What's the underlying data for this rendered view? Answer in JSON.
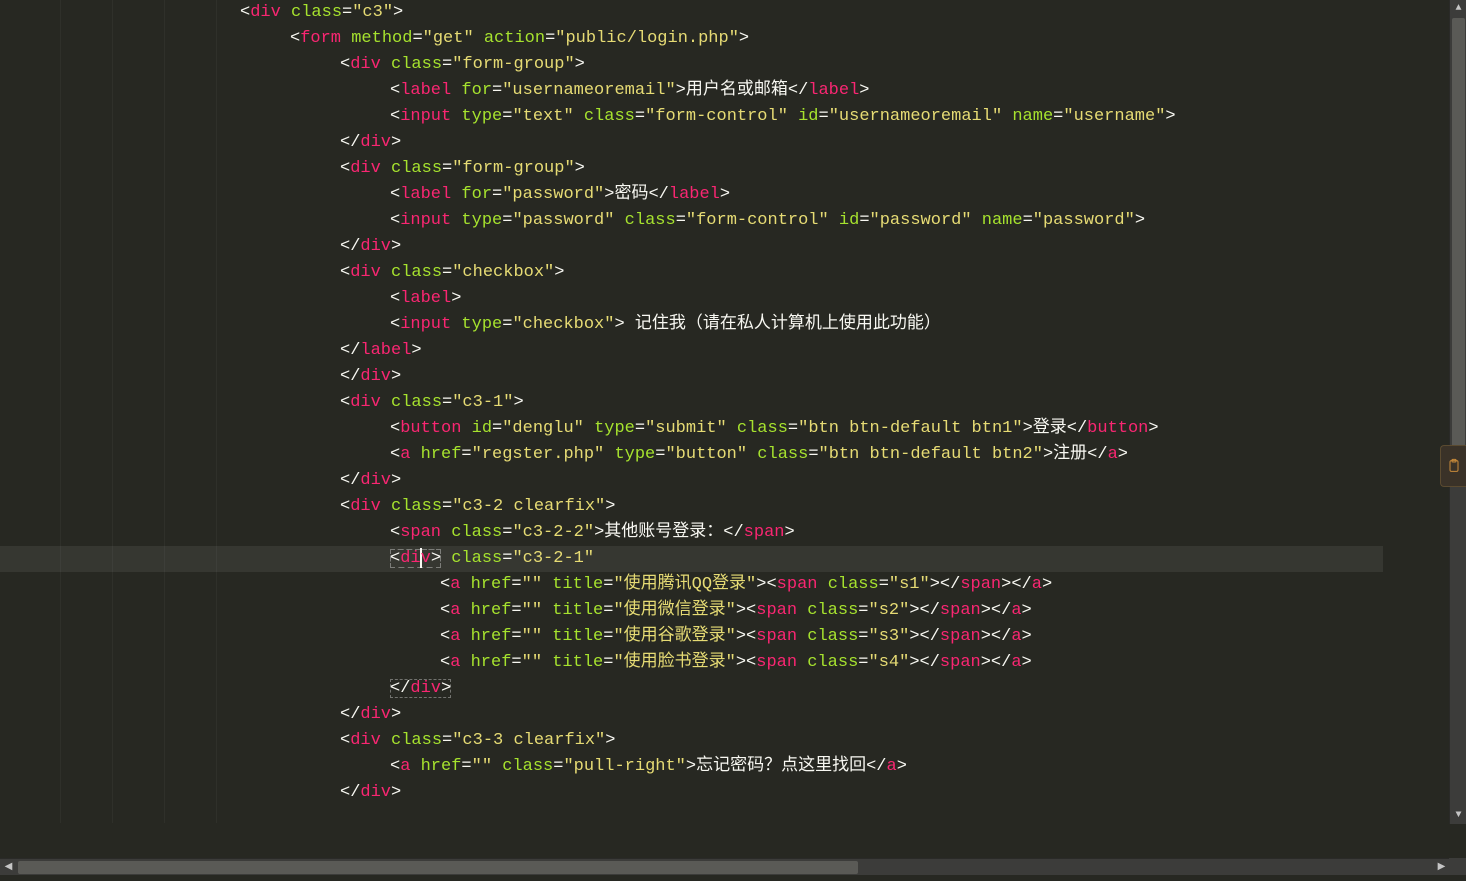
{
  "editor": {
    "indent_guides": 4,
    "highlighted_line_index": 21,
    "tokens": [
      [
        [
          "i",
          240
        ],
        [
          "p",
          "<"
        ],
        [
          "t",
          "div"
        ],
        [
          "p",
          " "
        ],
        [
          "a",
          "class"
        ],
        [
          "p",
          "="
        ],
        [
          "s",
          "\"c3\""
        ],
        [
          "p",
          ">"
        ]
      ],
      [
        [
          "i",
          290
        ],
        [
          "p",
          "<"
        ],
        [
          "t",
          "form"
        ],
        [
          "p",
          " "
        ],
        [
          "a",
          "method"
        ],
        [
          "p",
          "="
        ],
        [
          "s",
          "\"get\""
        ],
        [
          "p",
          " "
        ],
        [
          "a",
          "action"
        ],
        [
          "p",
          "="
        ],
        [
          "s",
          "\"public/login.php\""
        ],
        [
          "p",
          ">"
        ]
      ],
      [
        [
          "i",
          340
        ],
        [
          "p",
          "<"
        ],
        [
          "t",
          "div"
        ],
        [
          "p",
          " "
        ],
        [
          "a",
          "class"
        ],
        [
          "p",
          "="
        ],
        [
          "s",
          "\"form-group\""
        ],
        [
          "p",
          ">"
        ]
      ],
      [
        [
          "i",
          390
        ],
        [
          "p",
          "<"
        ],
        [
          "t",
          "label"
        ],
        [
          "p",
          " "
        ],
        [
          "a",
          "for"
        ],
        [
          "p",
          "="
        ],
        [
          "s",
          "\"usernameoremail\""
        ],
        [
          "p",
          ">"
        ],
        [
          "x",
          "用户名或邮箱"
        ],
        [
          "p",
          "</"
        ],
        [
          "t",
          "label"
        ],
        [
          "p",
          ">"
        ]
      ],
      [
        [
          "i",
          390
        ],
        [
          "p",
          "<"
        ],
        [
          "t",
          "input"
        ],
        [
          "p",
          " "
        ],
        [
          "a",
          "type"
        ],
        [
          "p",
          "="
        ],
        [
          "s",
          "\"text\""
        ],
        [
          "p",
          " "
        ],
        [
          "a",
          "class"
        ],
        [
          "p",
          "="
        ],
        [
          "s",
          "\"form-control\""
        ],
        [
          "p",
          " "
        ],
        [
          "a",
          "id"
        ],
        [
          "p",
          "="
        ],
        [
          "s",
          "\"usernameoremail\""
        ],
        [
          "p",
          " "
        ],
        [
          "a",
          "name"
        ],
        [
          "p",
          "="
        ],
        [
          "s",
          "\"username\""
        ],
        [
          "p",
          ">"
        ]
      ],
      [
        [
          "i",
          340
        ],
        [
          "p",
          "</"
        ],
        [
          "t",
          "div"
        ],
        [
          "p",
          ">"
        ]
      ],
      [
        [
          "i",
          340
        ],
        [
          "p",
          "<"
        ],
        [
          "t",
          "div"
        ],
        [
          "p",
          " "
        ],
        [
          "a",
          "class"
        ],
        [
          "p",
          "="
        ],
        [
          "s",
          "\"form-group\""
        ],
        [
          "p",
          ">"
        ]
      ],
      [
        [
          "i",
          390
        ],
        [
          "p",
          "<"
        ],
        [
          "t",
          "label"
        ],
        [
          "p",
          " "
        ],
        [
          "a",
          "for"
        ],
        [
          "p",
          "="
        ],
        [
          "s",
          "\"password\""
        ],
        [
          "p",
          ">"
        ],
        [
          "x",
          "密码"
        ],
        [
          "p",
          "</"
        ],
        [
          "t",
          "label"
        ],
        [
          "p",
          ">"
        ]
      ],
      [
        [
          "i",
          390
        ],
        [
          "p",
          "<"
        ],
        [
          "t",
          "input"
        ],
        [
          "p",
          " "
        ],
        [
          "a",
          "type"
        ],
        [
          "p",
          "="
        ],
        [
          "s",
          "\"password\""
        ],
        [
          "p",
          " "
        ],
        [
          "a",
          "class"
        ],
        [
          "p",
          "="
        ],
        [
          "s",
          "\"form-control\""
        ],
        [
          "p",
          " "
        ],
        [
          "a",
          "id"
        ],
        [
          "p",
          "="
        ],
        [
          "s",
          "\"password\""
        ],
        [
          "p",
          " "
        ],
        [
          "a",
          "name"
        ],
        [
          "p",
          "="
        ],
        [
          "s",
          "\"password\""
        ],
        [
          "p",
          ">"
        ]
      ],
      [
        [
          "i",
          340
        ],
        [
          "p",
          "</"
        ],
        [
          "t",
          "div"
        ],
        [
          "p",
          ">"
        ]
      ],
      [
        [
          "i",
          340
        ],
        [
          "p",
          "<"
        ],
        [
          "t",
          "div"
        ],
        [
          "p",
          " "
        ],
        [
          "a",
          "class"
        ],
        [
          "p",
          "="
        ],
        [
          "s",
          "\"checkbox\""
        ],
        [
          "p",
          ">"
        ]
      ],
      [
        [
          "i",
          390
        ],
        [
          "p",
          "<"
        ],
        [
          "t",
          "label"
        ],
        [
          "p",
          ">"
        ]
      ],
      [
        [
          "i",
          390
        ],
        [
          "p",
          "<"
        ],
        [
          "t",
          "input"
        ],
        [
          "p",
          " "
        ],
        [
          "a",
          "type"
        ],
        [
          "p",
          "="
        ],
        [
          "s",
          "\"checkbox\""
        ],
        [
          "p",
          ">"
        ],
        [
          "x",
          " 记住我（请在私人计算机上使用此功能）"
        ]
      ],
      [
        [
          "i",
          340
        ],
        [
          "p",
          "</"
        ],
        [
          "t",
          "label"
        ],
        [
          "p",
          ">"
        ]
      ],
      [
        [
          "i",
          340
        ],
        [
          "p",
          "</"
        ],
        [
          "t",
          "div"
        ],
        [
          "p",
          ">"
        ]
      ],
      [
        [
          "i",
          340
        ],
        [
          "p",
          "<"
        ],
        [
          "t",
          "div"
        ],
        [
          "p",
          " "
        ],
        [
          "a",
          "class"
        ],
        [
          "p",
          "="
        ],
        [
          "s",
          "\"c3-1\""
        ],
        [
          "p",
          ">"
        ]
      ],
      [
        [
          "i",
          390
        ],
        [
          "p",
          "<"
        ],
        [
          "t",
          "button"
        ],
        [
          "p",
          " "
        ],
        [
          "a",
          "id"
        ],
        [
          "p",
          "="
        ],
        [
          "s",
          "\"denglu\""
        ],
        [
          "p",
          " "
        ],
        [
          "a",
          "type"
        ],
        [
          "p",
          "="
        ],
        [
          "s",
          "\"submit\""
        ],
        [
          "p",
          " "
        ],
        [
          "a",
          "class"
        ],
        [
          "p",
          "="
        ],
        [
          "s",
          "\"btn btn-default btn1\""
        ],
        [
          "p",
          ">"
        ],
        [
          "x",
          "登录"
        ],
        [
          "p",
          "</"
        ],
        [
          "t",
          "button"
        ],
        [
          "p",
          ">"
        ]
      ],
      [
        [
          "i",
          390
        ],
        [
          "p",
          "<"
        ],
        [
          "t",
          "a"
        ],
        [
          "p",
          " "
        ],
        [
          "a",
          "href"
        ],
        [
          "p",
          "="
        ],
        [
          "s",
          "\"regster.php\""
        ],
        [
          "p",
          " "
        ],
        [
          "a",
          "type"
        ],
        [
          "p",
          "="
        ],
        [
          "s",
          "\"button\""
        ],
        [
          "p",
          " "
        ],
        [
          "a",
          "class"
        ],
        [
          "p",
          "="
        ],
        [
          "s",
          "\"btn btn-default btn2\""
        ],
        [
          "p",
          ">"
        ],
        [
          "x",
          "注册"
        ],
        [
          "p",
          "</"
        ],
        [
          "t",
          "a"
        ],
        [
          "p",
          ">"
        ]
      ],
      [
        [
          "i",
          340
        ],
        [
          "p",
          "</"
        ],
        [
          "t",
          "div"
        ],
        [
          "p",
          ">"
        ]
      ],
      [
        [
          "i",
          340
        ],
        [
          "p",
          "<"
        ],
        [
          "t",
          "div"
        ],
        [
          "p",
          " "
        ],
        [
          "a",
          "class"
        ],
        [
          "p",
          "="
        ],
        [
          "s",
          "\"c3-2 clearfix\""
        ],
        [
          "p",
          ">"
        ]
      ],
      [
        [
          "i",
          390
        ],
        [
          "p",
          "<"
        ],
        [
          "t",
          "span"
        ],
        [
          "p",
          " "
        ],
        [
          "a",
          "class"
        ],
        [
          "p",
          "="
        ],
        [
          "s",
          "\"c3-2-2\""
        ],
        [
          "p",
          ">"
        ],
        [
          "x",
          "其他账号登录："
        ],
        [
          "p",
          "</"
        ],
        [
          "t",
          "span"
        ],
        [
          "p",
          ">"
        ]
      ],
      [
        [
          "i",
          390
        ],
        [
          "bo",
          "<"
        ],
        [
          "bt",
          "di"
        ],
        [
          "cur",
          ""
        ],
        [
          "bt",
          "v"
        ],
        [
          "p",
          " "
        ],
        [
          "a",
          "class"
        ],
        [
          "p",
          "="
        ],
        [
          "s",
          "\"c3-2-1\""
        ],
        [
          "bc",
          ">"
        ]
      ],
      [
        [
          "i",
          440
        ],
        [
          "p",
          "<"
        ],
        [
          "t",
          "a"
        ],
        [
          "p",
          " "
        ],
        [
          "a",
          "href"
        ],
        [
          "p",
          "="
        ],
        [
          "s",
          "\"\""
        ],
        [
          "p",
          " "
        ],
        [
          "a",
          "title"
        ],
        [
          "p",
          "="
        ],
        [
          "s",
          "\"使用腾讯QQ登录\""
        ],
        [
          "p",
          "><"
        ],
        [
          "t",
          "span"
        ],
        [
          "p",
          " "
        ],
        [
          "a",
          "class"
        ],
        [
          "p",
          "="
        ],
        [
          "s",
          "\"s1\""
        ],
        [
          "p",
          "></"
        ],
        [
          "t",
          "span"
        ],
        [
          "p",
          "></"
        ],
        [
          "t",
          "a"
        ],
        [
          "p",
          ">"
        ]
      ],
      [
        [
          "i",
          440
        ],
        [
          "p",
          "<"
        ],
        [
          "t",
          "a"
        ],
        [
          "p",
          " "
        ],
        [
          "a",
          "href"
        ],
        [
          "p",
          "="
        ],
        [
          "s",
          "\"\""
        ],
        [
          "p",
          " "
        ],
        [
          "a",
          "title"
        ],
        [
          "p",
          "="
        ],
        [
          "s",
          "\"使用微信登录\""
        ],
        [
          "p",
          "><"
        ],
        [
          "t",
          "span"
        ],
        [
          "p",
          " "
        ],
        [
          "a",
          "class"
        ],
        [
          "p",
          "="
        ],
        [
          "s",
          "\"s2\""
        ],
        [
          "p",
          "></"
        ],
        [
          "t",
          "span"
        ],
        [
          "p",
          "></"
        ],
        [
          "t",
          "a"
        ],
        [
          "p",
          ">"
        ]
      ],
      [
        [
          "i",
          440
        ],
        [
          "p",
          "<"
        ],
        [
          "t",
          "a"
        ],
        [
          "p",
          " "
        ],
        [
          "a",
          "href"
        ],
        [
          "p",
          "="
        ],
        [
          "s",
          "\"\""
        ],
        [
          "p",
          " "
        ],
        [
          "a",
          "title"
        ],
        [
          "p",
          "="
        ],
        [
          "s",
          "\"使用谷歌登录\""
        ],
        [
          "p",
          "><"
        ],
        [
          "t",
          "span"
        ],
        [
          "p",
          " "
        ],
        [
          "a",
          "class"
        ],
        [
          "p",
          "="
        ],
        [
          "s",
          "\"s3\""
        ],
        [
          "p",
          "></"
        ],
        [
          "t",
          "span"
        ],
        [
          "p",
          "></"
        ],
        [
          "t",
          "a"
        ],
        [
          "p",
          ">"
        ]
      ],
      [
        [
          "i",
          440
        ],
        [
          "p",
          "<"
        ],
        [
          "t",
          "a"
        ],
        [
          "p",
          " "
        ],
        [
          "a",
          "href"
        ],
        [
          "p",
          "="
        ],
        [
          "s",
          "\"\""
        ],
        [
          "p",
          " "
        ],
        [
          "a",
          "title"
        ],
        [
          "p",
          "="
        ],
        [
          "s",
          "\"使用脸书登录\""
        ],
        [
          "p",
          "><"
        ],
        [
          "t",
          "span"
        ],
        [
          "p",
          " "
        ],
        [
          "a",
          "class"
        ],
        [
          "p",
          "="
        ],
        [
          "s",
          "\"s4\""
        ],
        [
          "p",
          "></"
        ],
        [
          "t",
          "span"
        ],
        [
          "p",
          "></"
        ],
        [
          "t",
          "a"
        ],
        [
          "p",
          ">"
        ]
      ],
      [
        [
          "i",
          390
        ],
        [
          "bc2",
          "</"
        ],
        [
          "bt",
          "div"
        ],
        [
          "bc2",
          ">"
        ]
      ],
      [
        [
          "i",
          340
        ],
        [
          "p",
          "</"
        ],
        [
          "t",
          "div"
        ],
        [
          "p",
          ">"
        ]
      ],
      [
        [
          "i",
          340
        ],
        [
          "p",
          "<"
        ],
        [
          "t",
          "div"
        ],
        [
          "p",
          " "
        ],
        [
          "a",
          "class"
        ],
        [
          "p",
          "="
        ],
        [
          "s",
          "\"c3-3 clearfix\""
        ],
        [
          "p",
          ">"
        ]
      ],
      [
        [
          "i",
          390
        ],
        [
          "p",
          "<"
        ],
        [
          "t",
          "a"
        ],
        [
          "p",
          " "
        ],
        [
          "a",
          "href"
        ],
        [
          "p",
          "="
        ],
        [
          "s",
          "\"\""
        ],
        [
          "p",
          " "
        ],
        [
          "a",
          "class"
        ],
        [
          "p",
          "="
        ],
        [
          "s",
          "\"pull-right\""
        ],
        [
          "p",
          ">"
        ],
        [
          "x",
          "忘记密码？点这里找回"
        ],
        [
          "p",
          "</"
        ],
        [
          "t",
          "a"
        ],
        [
          "p",
          ">"
        ]
      ],
      [
        [
          "i",
          340
        ],
        [
          "p",
          "</"
        ],
        [
          "t",
          "div"
        ],
        [
          "p",
          ">"
        ]
      ]
    ]
  }
}
